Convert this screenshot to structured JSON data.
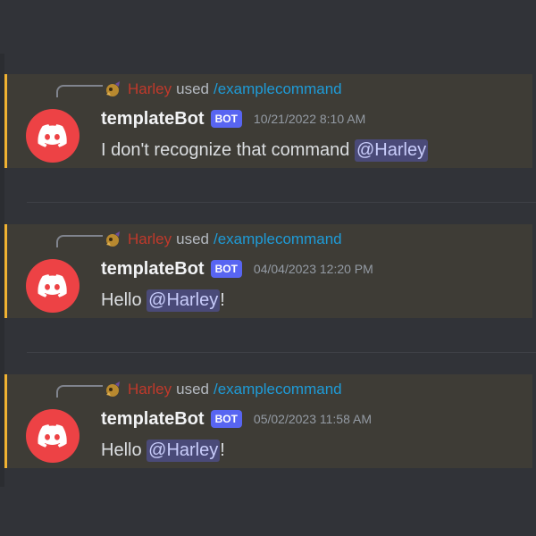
{
  "messages": [
    {
      "reply": {
        "user": "Harley",
        "used": "used",
        "command": "/examplecommand"
      },
      "author": "templateBot",
      "tag": "BOT",
      "timestamp": "10/21/2022 8:10 AM",
      "text_before": "I don't recognize that command ",
      "mention": "@Harley",
      "text_after": ""
    },
    {
      "reply": {
        "user": "Harley",
        "used": "used",
        "command": "/examplecommand"
      },
      "author": "templateBot",
      "tag": "BOT",
      "timestamp": "04/04/2023 12:20 PM",
      "text_before": "Hello ",
      "mention": "@Harley",
      "text_after": "!"
    },
    {
      "reply": {
        "user": "Harley",
        "used": "used",
        "command": "/examplecommand"
      },
      "author": "templateBot",
      "tag": "BOT",
      "timestamp": "05/02/2023 11:58 AM",
      "text_before": "Hello ",
      "mention": "@Harley",
      "text_after": "!"
    }
  ],
  "colors": {
    "background": "#313338",
    "highlight": "#3e3c36",
    "highlight_border": "#f0b232",
    "avatar": "#ed4245",
    "bot_tag": "#5865f2",
    "command": "#1e9bd7",
    "reply_user": "#c0392b",
    "mention_bg": "#4a4a78"
  },
  "icons": {
    "avatar": "discord-logo-icon",
    "reply_avatar": "reply-user-avatar-icon"
  }
}
